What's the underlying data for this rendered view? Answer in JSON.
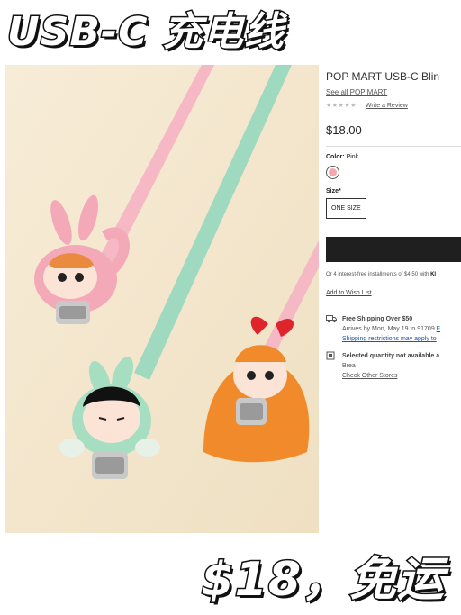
{
  "headline": "USB-C 充电线",
  "footer_price": "$18，免运",
  "product": {
    "title": "POP MART USB-C Blin",
    "brand_link": "See all POP MART",
    "stars": "★★★★★",
    "review_link": "Write a Review",
    "price": "$18.00",
    "color_label": "Color:",
    "color_value": "Pink",
    "color_swatch": "#f4a7ad",
    "size_label": "Size*",
    "size_option": "ONE SIZE",
    "installments_text": "Or 4 interest-free installments of $4.50 with",
    "installments_brand": "Kl",
    "wishlist": "Add to Wish List",
    "shipping": {
      "title": "Free Shipping Over $50",
      "arrives": "Arrives by Mon, May 19 to 91709",
      "arrives_link": "F",
      "restrictions": "Shipping restrictions may apply to"
    },
    "store": {
      "title": "Selected quantity not available a",
      "location": "Brea",
      "link": "Check Other Stores"
    }
  }
}
